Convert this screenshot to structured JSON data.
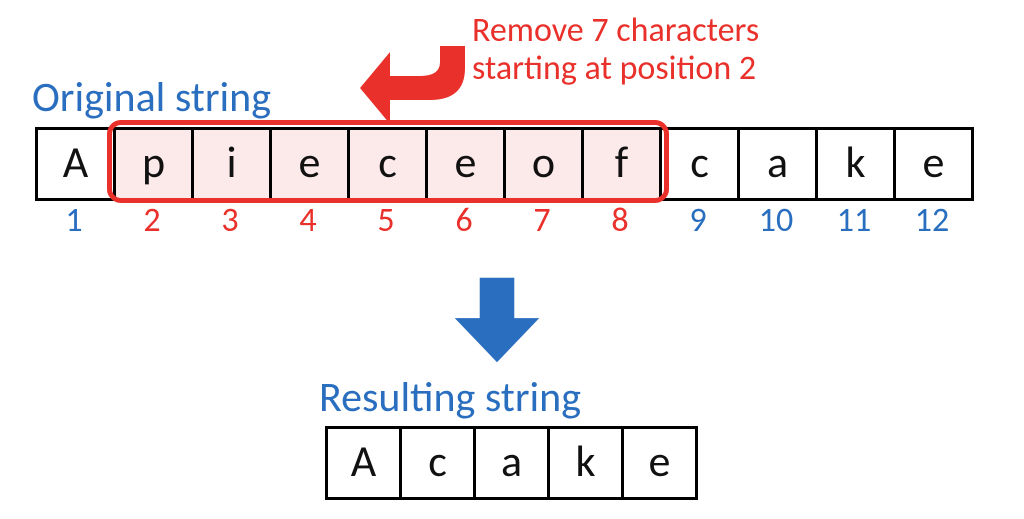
{
  "label_original": "Original string",
  "label_result": "Resulting string",
  "annotation_line1": "Remove 7 characters",
  "annotation_line2": "starting at position 2",
  "original": {
    "chars": [
      "A",
      "p",
      "i",
      "e",
      "c",
      "e",
      "o",
      "f",
      "c",
      "a",
      "k",
      "e"
    ],
    "highlight_start": 2,
    "highlight_end": 8
  },
  "result_chars": [
    "A",
    "c",
    "a",
    "k",
    "e"
  ],
  "indices": [
    {
      "n": "1",
      "c": "blue"
    },
    {
      "n": "2",
      "c": "red"
    },
    {
      "n": "3",
      "c": "red"
    },
    {
      "n": "4",
      "c": "red"
    },
    {
      "n": "5",
      "c": "red"
    },
    {
      "n": "6",
      "c": "red"
    },
    {
      "n": "7",
      "c": "red"
    },
    {
      "n": "8",
      "c": "red"
    },
    {
      "n": "9",
      "c": "blue"
    },
    {
      "n": "10",
      "c": "blue"
    },
    {
      "n": "11",
      "c": "blue"
    },
    {
      "n": "12",
      "c": "blue"
    }
  ],
  "colors": {
    "blue": "#2a6ebf",
    "red": "#e9302a",
    "highlight_fill": "#fce9e9"
  }
}
